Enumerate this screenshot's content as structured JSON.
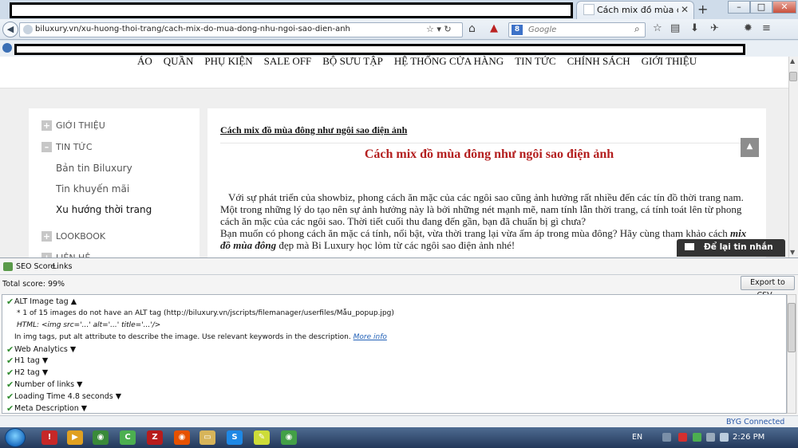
{
  "browser": {
    "tab_title": "Cách mix đồ mùa đông ...",
    "url": "biluxury.vn/xu-huong-thoi-trang/cach-mix-do-mua-dong-nhu-ngoi-sao-dien-anh",
    "search_engine": "Google",
    "search_placeholder": "Google",
    "window_buttons": {
      "minimize": "–",
      "maximize": "□",
      "close": "✕"
    }
  },
  "site": {
    "menu": [
      "ÁO",
      "QUẦN",
      "PHỤ KIỆN",
      "SALE OFF",
      "BỘ SƯU TẬP",
      "HỆ THỐNG CỬA HÀNG",
      "TIN TỨC",
      "CHÍNH SÁCH",
      "GIỚI THIỆU"
    ],
    "sidebar": {
      "items": [
        {
          "label": "GIỚI THIỆU",
          "marker": "+"
        },
        {
          "label": "TIN TỨC",
          "marker": "–"
        },
        {
          "label": "LOOKBOOK",
          "marker": "+"
        },
        {
          "label": "LIÊN HỆ",
          "marker": "+"
        }
      ],
      "subitems": [
        "Bản tin Biluxury",
        "Tin khuyến mãi",
        "Xu hướng thời trang"
      ]
    },
    "breadcrumb": "Cách mix đồ mùa đông như ngôi sao điện ảnh",
    "article": {
      "title": "Cách mix đồ mùa đông như ngôi sao điện ảnh",
      "para1": "Với sự phát triển của showbiz, phong cách ăn mặc của các ngôi sao cũng ảnh hưởng rất nhiều đến các tín đồ thời trang nam. Một trong những lý do tạo nên sự ảnh hưởng này là bởi những nét mạnh mẽ, nam tính lẫn thời trang, cá tính toát lên từ phong cách ăn mặc của các ngôi sao. Thời tiết cuối thu đang đến gần, bạn đã chuẩn bị gì chưa?",
      "para2_before": "Bạn muốn có phong cách ăn mặc cá tính, nổi bật, vừa thời trang lại vừa ấm áp trong mùa đông? Hãy cùng tham khảo cách ",
      "para2_emph": "mix đồ mùa đông",
      "para2_after": " đẹp mà Bi Luxury học lỏm từ các ngôi sao điện ảnh nhé!"
    },
    "chat_label": "Để lại tin nhắn"
  },
  "seo_panel": {
    "tabs": [
      "SEO Score",
      "Links"
    ],
    "total_score": "Total score: 99%",
    "export_label": "Export to CSV...",
    "results": [
      {
        "label": "ALT Image tag",
        "arrow": "▲",
        "expanded": true
      },
      {
        "label": "Web Analytics",
        "arrow": "▼"
      },
      {
        "label": "H1 tag",
        "arrow": "▼"
      },
      {
        "label": "H2 tag",
        "arrow": "▼"
      },
      {
        "label": "Number of links",
        "arrow": "▼"
      },
      {
        "label": "Loading Time  4.8 seconds",
        "arrow": "▼"
      },
      {
        "label": "Meta Description",
        "arrow": "▼"
      }
    ],
    "alt_details": {
      "line1": "* 1 of 15 images do not have an ALT tag (http://biluxury.vn/jscripts/filemanager/userfiles/Mẫu_popup.jpg)",
      "line2": "HTML: <img src='...' alt='...' title='...'/>",
      "line3": "In img tags, put alt attribute to describe the image. Use relevant keywords in the description.",
      "more_info": "More info"
    }
  },
  "status": {
    "byg": "BYG Connected"
  },
  "taskbar": {
    "lang": "EN",
    "clock": "2:26 PM"
  }
}
